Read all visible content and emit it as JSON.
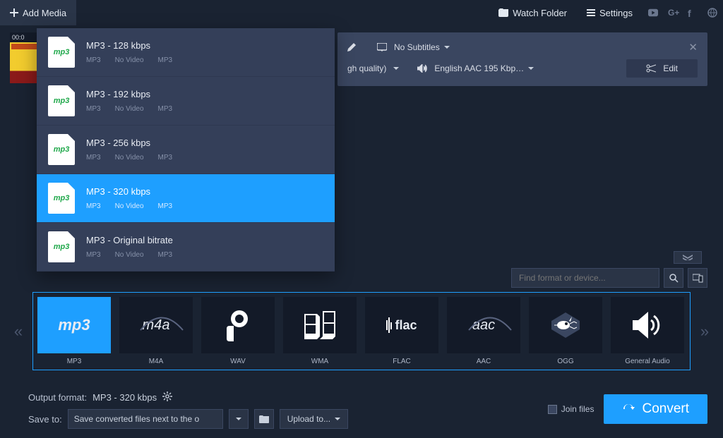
{
  "topbar": {
    "add_media": "Add Media",
    "watch_folder": "Watch Folder",
    "settings": "Settings"
  },
  "file_panel": {
    "quality_suffix": "gh quality)",
    "subtitles_label": "No Subtitles",
    "audio_label": "English AAC 195 Kbp…",
    "edit_label": "Edit"
  },
  "thumbnail": {
    "timecode": "00:0"
  },
  "presets": [
    {
      "title": "MP3 - 128 kbps",
      "tags": [
        "MP3",
        "No Video",
        "MP3"
      ],
      "selected": false
    },
    {
      "title": "MP3 - 192 kbps",
      "tags": [
        "MP3",
        "No Video",
        "MP3"
      ],
      "selected": false
    },
    {
      "title": "MP3 - 256 kbps",
      "tags": [
        "MP3",
        "No Video",
        "MP3"
      ],
      "selected": false
    },
    {
      "title": "MP3 - 320 kbps",
      "tags": [
        "MP3",
        "No Video",
        "MP3"
      ],
      "selected": true
    },
    {
      "title": "MP3 - Original bitrate",
      "tags": [
        "MP3",
        "No Video",
        "MP3"
      ],
      "selected": false
    }
  ],
  "preset_icon_text": "mp3",
  "search": {
    "placeholder": "Find format or device..."
  },
  "formats": [
    {
      "label": "MP3",
      "icon": "mp3",
      "selected": true
    },
    {
      "label": "M4A",
      "icon": "m4a",
      "selected": false
    },
    {
      "label": "WAV",
      "icon": "wav",
      "selected": false
    },
    {
      "label": "WMA",
      "icon": "wma",
      "selected": false
    },
    {
      "label": "FLAC",
      "icon": "flac",
      "selected": false
    },
    {
      "label": "AAC",
      "icon": "aac",
      "selected": false
    },
    {
      "label": "OGG",
      "icon": "ogg",
      "selected": false
    },
    {
      "label": "General Audio",
      "icon": "speaker",
      "selected": false
    }
  ],
  "bottom": {
    "output_format_label": "Output format:",
    "output_format_value": "MP3 - 320 kbps",
    "save_to_label": "Save to:",
    "save_to_value": "Save converted files next to the o",
    "upload_label": "Upload to...",
    "join_files": "Join files",
    "convert": "Convert"
  }
}
